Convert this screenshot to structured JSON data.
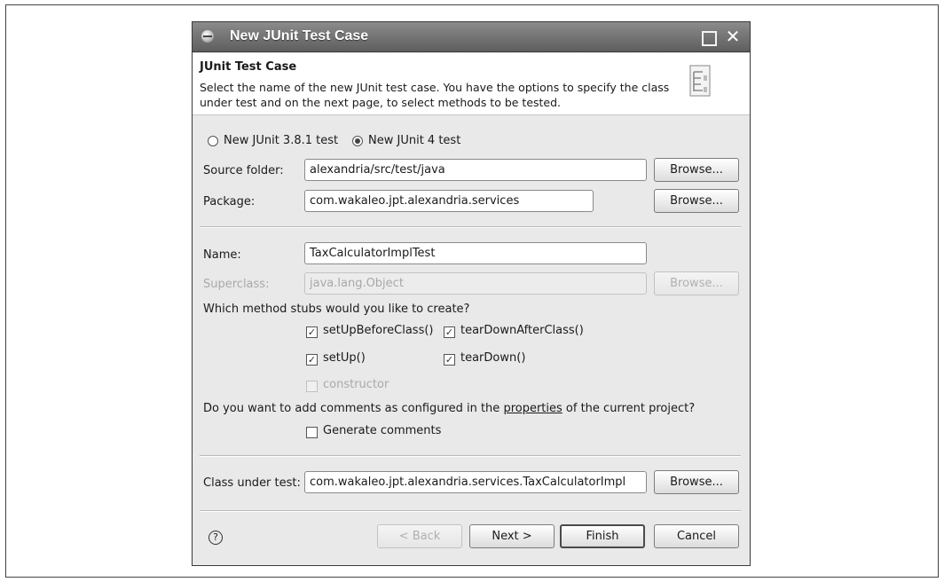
{
  "window": {
    "title": "New JUnit Test Case",
    "icon": "eclipse-icon",
    "controls": [
      "maximize-icon",
      "close-icon"
    ]
  },
  "header": {
    "title": "JUnit Test Case",
    "description": "Select the name of the new JUnit test case. You have the options to specify the class under test and on the next page, to select methods to be tested.",
    "image": "junit-wizard-banner-icon"
  },
  "version": {
    "options": [
      {
        "label": "New JUnit 3.8.1 test",
        "selected": false
      },
      {
        "label": "New JUnit 4 test",
        "selected": true
      }
    ]
  },
  "source_folder": {
    "label": "Source folder:",
    "value": "alexandria/src/test/java",
    "browse_label": "Browse..."
  },
  "package": {
    "label": "Package:",
    "value": "com.wakaleo.jpt.alexandria.services",
    "browse_label": "Browse..."
  },
  "name": {
    "label": "Name:",
    "value": "TaxCalculatorImplTest"
  },
  "superclass": {
    "label": "Superclass:",
    "value": "java.lang.Object",
    "browse_label": "Browse...",
    "enabled": false
  },
  "stubs": {
    "question": "Which method stubs would you like to create?",
    "items": [
      {
        "label": "setUpBeforeClass()",
        "checked": true,
        "enabled": true
      },
      {
        "label": "tearDownAfterClass()",
        "checked": true,
        "enabled": true
      },
      {
        "label": "setUp()",
        "checked": true,
        "enabled": true
      },
      {
        "label": "tearDown()",
        "checked": true,
        "enabled": true
      },
      {
        "label": "constructor",
        "checked": false,
        "enabled": false
      }
    ]
  },
  "comments": {
    "question_prefix": "Do you want to add comments as configured in the",
    "question_link": "properties",
    "question_suffix": "of the current project?",
    "generate_label": "Generate comments",
    "checked": false
  },
  "class_under_test": {
    "label": "Class under test:",
    "value": "com.wakaleo.jpt.alexandria.services.TaxCalculatorImpl",
    "browse_label": "Browse..."
  },
  "footer": {
    "help_icon": "help-icon",
    "back_label": "< Back",
    "next_label": "Next >",
    "finish_label": "Finish",
    "cancel_label": "Cancel"
  }
}
